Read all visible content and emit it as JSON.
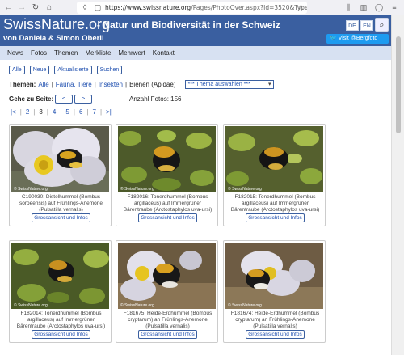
{
  "browser": {
    "url_host": "https://www.swissnature.org",
    "url_path": "/Pages/PhotoOver.aspx?Id=3520&Type=M"
  },
  "header": {
    "logo": "SwissNature.org",
    "tagline": "- Natur und Biodiversität in der Schweiz",
    "byline": "von Daniela & Simon Oberli",
    "lang_de": "DE",
    "lang_en": "EN",
    "visit": "Visit @Bergfoto"
  },
  "nav": [
    "News",
    "Fotos",
    "Themen",
    "Merkliste",
    "Mehrwert",
    "Kontakt"
  ],
  "buttons": [
    "Alle",
    "Neue",
    "Aktualisierte",
    "Suchen"
  ],
  "themes": {
    "label": "Themen:",
    "all": "Alle",
    "fauna": "Fauna, Tiere",
    "insects": "Insekten",
    "current": "Bienen (Apidae)",
    "select": "*** Thema auswählen ***"
  },
  "pagination": {
    "goto_label": "Gehe zu Seite:",
    "prev": "<",
    "next": ">",
    "count_label": "Anzahl Fotos:",
    "count": "156",
    "pages": [
      "|<",
      "2",
      "3",
      "4",
      "5",
      "6",
      "7",
      ">|"
    ],
    "current": "3"
  },
  "cards": [
    {
      "caption": "C190030: Distelhummel (Bombus soroeensis) auf Frühlings-Anemone (Pulsatilla vernalis)",
      "button": "Grossansicht und Infos",
      "watermark": "© SwissNature.org"
    },
    {
      "caption": "F182016: Tonerdhummel (Bombus argillaceus) auf Immergrüner Bärentraube (Arctostaphylos uva-ursi)",
      "button": "Grossansicht und Infos",
      "watermark": "© SwissNature.org"
    },
    {
      "caption": "F182015: Tonerdhummel (Bombus argillaceus) auf Immergrüner Bärentraube (Arctostaphylos uva-ursi)",
      "button": "Grossansicht und Infos",
      "watermark": "© SwissNature.org"
    },
    {
      "caption": "F182014: Tonerdhummel (Bombus argillaceus) auf Immergrüner Bärentraube (Arctostaphylos uva-ursi)",
      "button": "Grossansicht und Infos",
      "watermark": "© SwissNature.org"
    },
    {
      "caption": "F181675: Heide-Erdhummel (Bombus cryptarum) an Frühlings-Anemone (Pulsatilla vernalis)",
      "button": "Grossansicht und Infos",
      "watermark": "© SwissNature.org"
    },
    {
      "caption": "F181674: Heide-Erdhummel (Bombus cryptarum) an Frühlings-Anemone (Pulsatilla vernalis)",
      "button": "Grossansicht und Infos",
      "watermark": "© SwissNature.org"
    }
  ]
}
